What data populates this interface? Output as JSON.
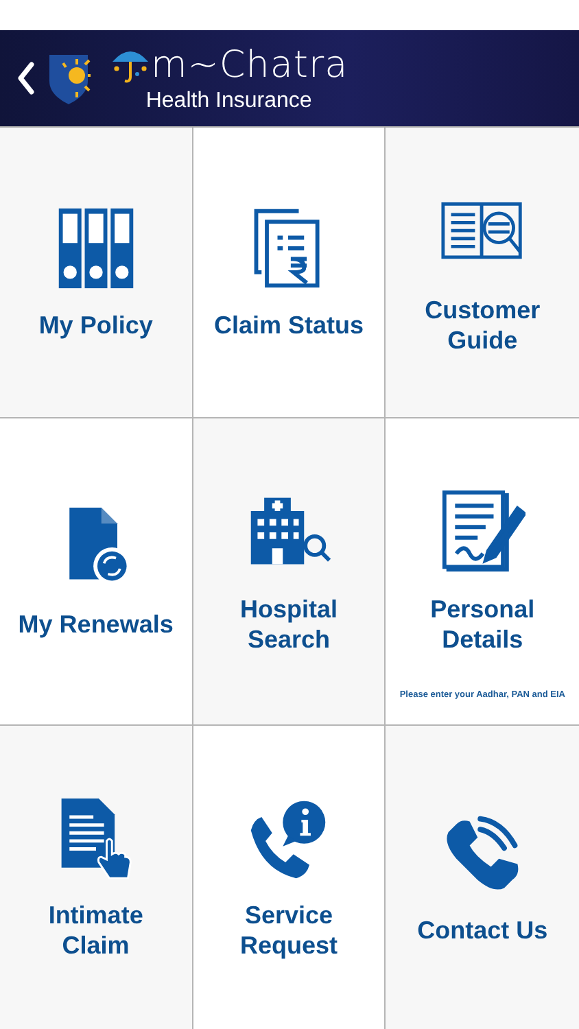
{
  "header": {
    "app_name": "m~Chatra",
    "subtitle": "Health Insurance"
  },
  "tiles": [
    {
      "lines": [
        "My Policy"
      ]
    },
    {
      "lines": [
        "Claim Status"
      ]
    },
    {
      "lines": [
        "Customer",
        "Guide"
      ]
    },
    {
      "lines": [
        "My Renewals"
      ]
    },
    {
      "lines": [
        "Hospital",
        "Search"
      ]
    },
    {
      "lines": [
        "Personal",
        "Details"
      ],
      "note": "Please enter your Aadhar, PAN and EIA"
    },
    {
      "lines": [
        "Intimate",
        "Claim"
      ]
    },
    {
      "lines": [
        "Service",
        "Request"
      ]
    },
    {
      "lines": [
        "Contact Us"
      ]
    }
  ]
}
